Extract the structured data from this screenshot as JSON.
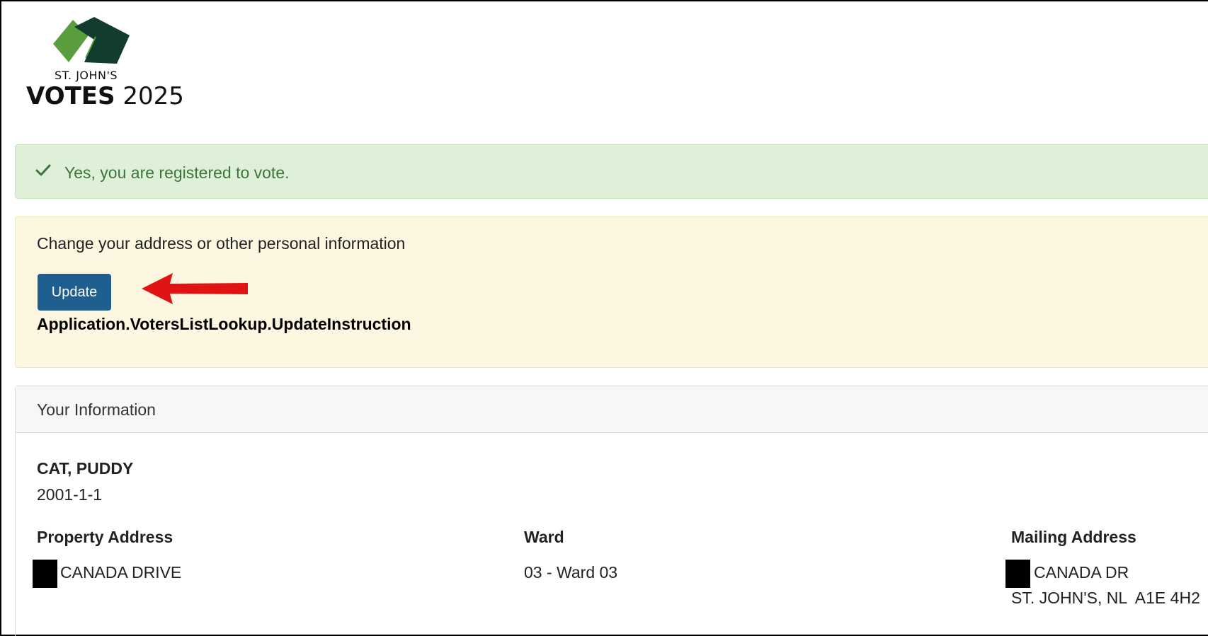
{
  "logo": {
    "line1": "ST. JOHN'S",
    "votes": "VOTES",
    "year": "2025"
  },
  "registration_status": {
    "message": "Yes, you are registered to vote."
  },
  "update_panel": {
    "prompt": "Change your address or other personal information",
    "button_label": "Update",
    "instruction": "Application.VotersListLookup.UpdateInstruction"
  },
  "info": {
    "header": "Your Information",
    "name": "CAT, PUDDY",
    "dob": "2001-1-1",
    "property_address_label": "Property Address",
    "property_address": "CANADA DRIVE",
    "ward_label": "Ward",
    "ward": "03 - Ward 03",
    "mailing_address_label": "Mailing Address",
    "mailing_address_line1": "CANADA DR",
    "mailing_address_line2": "ST. JOHN'S, NL  A1E 4H2"
  },
  "colors": {
    "success_bg": "#dff0d8",
    "success_text": "#3c763d",
    "warning_bg": "#fdf7e2",
    "button_bg": "#1f5f8f",
    "arrow": "#e11414"
  }
}
